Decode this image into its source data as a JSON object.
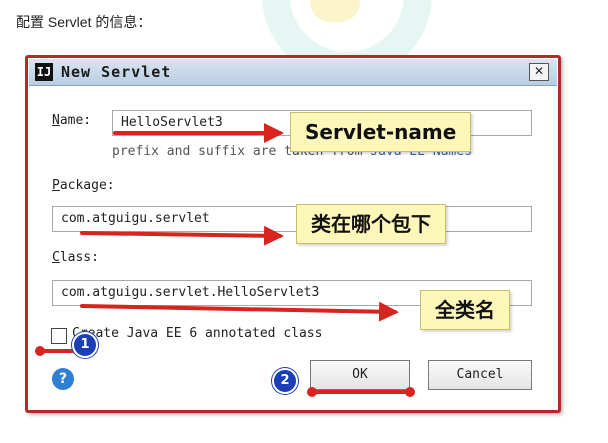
{
  "page": {
    "caption": "配置 Servlet 的信息："
  },
  "dialog": {
    "title": "New Servlet",
    "close_glyph": "✕",
    "app_icon_glyph": "IJ",
    "name": {
      "label_mnemonic": "N",
      "label_rest": "ame:",
      "value": "HelloServlet3",
      "hint_prefix": "prefix and suffix are taken from",
      "hint_link": "Java EE Names"
    },
    "package": {
      "label_mnemonic": "P",
      "label_rest": "ackage:",
      "value": "com.atguigu.servlet"
    },
    "class": {
      "label_mnemonic": "C",
      "label_rest": "lass:",
      "value": "com.atguigu.servlet.HelloServlet3"
    },
    "checkbox": {
      "label": "Create Java EE 6 annotated class",
      "checked": false
    },
    "help_glyph": "?",
    "ok_label": "OK",
    "cancel_label": "Cancel"
  },
  "annotations": {
    "callout_name": "Servlet-name",
    "callout_package": "类在哪个包下",
    "callout_class": "全类名",
    "badge_1": "1",
    "badge_2": "2",
    "arrow_color": "#d8231e"
  },
  "colors": {
    "frame": "#b22a2a",
    "callout_fill": "#fdf7b9",
    "badge": "#1a3fb6",
    "help": "#2f7fd3"
  }
}
